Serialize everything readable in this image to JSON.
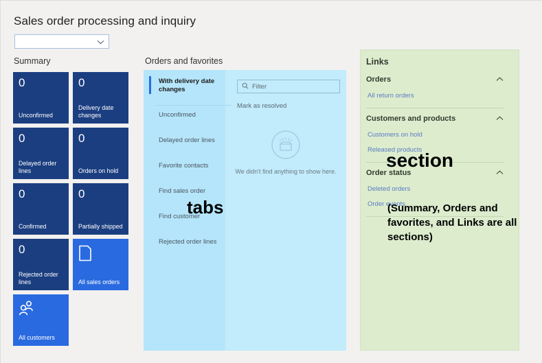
{
  "header": {
    "title": "Sales order processing and inquiry",
    "picker_value": "",
    "picker_icon": "chevron-down-icon"
  },
  "summary": {
    "heading": "Summary",
    "tiles": [
      {
        "count": "0",
        "label": "Unconfirmed",
        "kind": "count",
        "color": "#1b3e80"
      },
      {
        "count": "0",
        "label": "Delivery date changes",
        "kind": "count",
        "color": "#1b3e80"
      },
      {
        "count": "0",
        "label": "Delayed order lines",
        "kind": "count",
        "color": "#1b3e80"
      },
      {
        "count": "0",
        "label": "Orders on hold",
        "kind": "count",
        "color": "#1b3e80"
      },
      {
        "count": "0",
        "label": "Confirmed",
        "kind": "count",
        "color": "#1b3e80"
      },
      {
        "count": "0",
        "label": "Partially shipped",
        "kind": "count",
        "color": "#1b3e80"
      },
      {
        "count": "0",
        "label": "Rejected order lines",
        "kind": "count",
        "color": "#1b3e80"
      },
      {
        "count": "",
        "label": "All sales orders",
        "kind": "action",
        "icon": "document-icon",
        "color": "#2a6ae0"
      },
      {
        "count": "",
        "label": "All customers",
        "kind": "action",
        "icon": "people-icon",
        "color": "#2a6ae0"
      }
    ]
  },
  "orders_and_favorites": {
    "heading": "Orders and favorites",
    "tabs": [
      {
        "label": "With delivery date changes",
        "selected": true
      },
      {
        "label": "Unconfirmed",
        "selected": false
      },
      {
        "label": "Delayed order lines",
        "selected": false
      },
      {
        "label": "Favorite contacts",
        "selected": false
      },
      {
        "label": "Find sales order",
        "selected": false
      },
      {
        "label": "Find customer",
        "selected": false
      },
      {
        "label": "Rejected order lines",
        "selected": false
      }
    ],
    "filter_placeholder": "Filter",
    "filter_value": "",
    "filter_icon": "search-icon",
    "mark_as_resolved_label": "Mark as resolved",
    "empty_state": {
      "icon": "empty-box-icon",
      "message": "We didn't find anything to show here."
    }
  },
  "links": {
    "heading": "Links",
    "groups": [
      {
        "title": "Orders",
        "chevron": "chevron-up-icon",
        "items": [
          "All return orders"
        ]
      },
      {
        "title": "Customers and products",
        "chevron": "chevron-up-icon",
        "items": [
          "Customers on hold",
          "Released products"
        ]
      },
      {
        "title": "Order status",
        "chevron": "chevron-up-icon",
        "items": [
          "Deleted orders",
          "Order events"
        ]
      }
    ]
  },
  "annotations": {
    "tabs": "tabs",
    "section": "section",
    "note": "(Summary, Orders and favorites, and Links are all sections)"
  },
  "colors": {
    "canvas": "#f2f1f0",
    "tile_navy": "#1b3e80",
    "tile_blue": "#2a6ae0",
    "orders_panel": "#c2ebfb",
    "tab_rail": "#b5e5fa",
    "links_panel": "#dceccd",
    "link_text": "#5b7cc4",
    "accent": "#2a6ae0"
  }
}
